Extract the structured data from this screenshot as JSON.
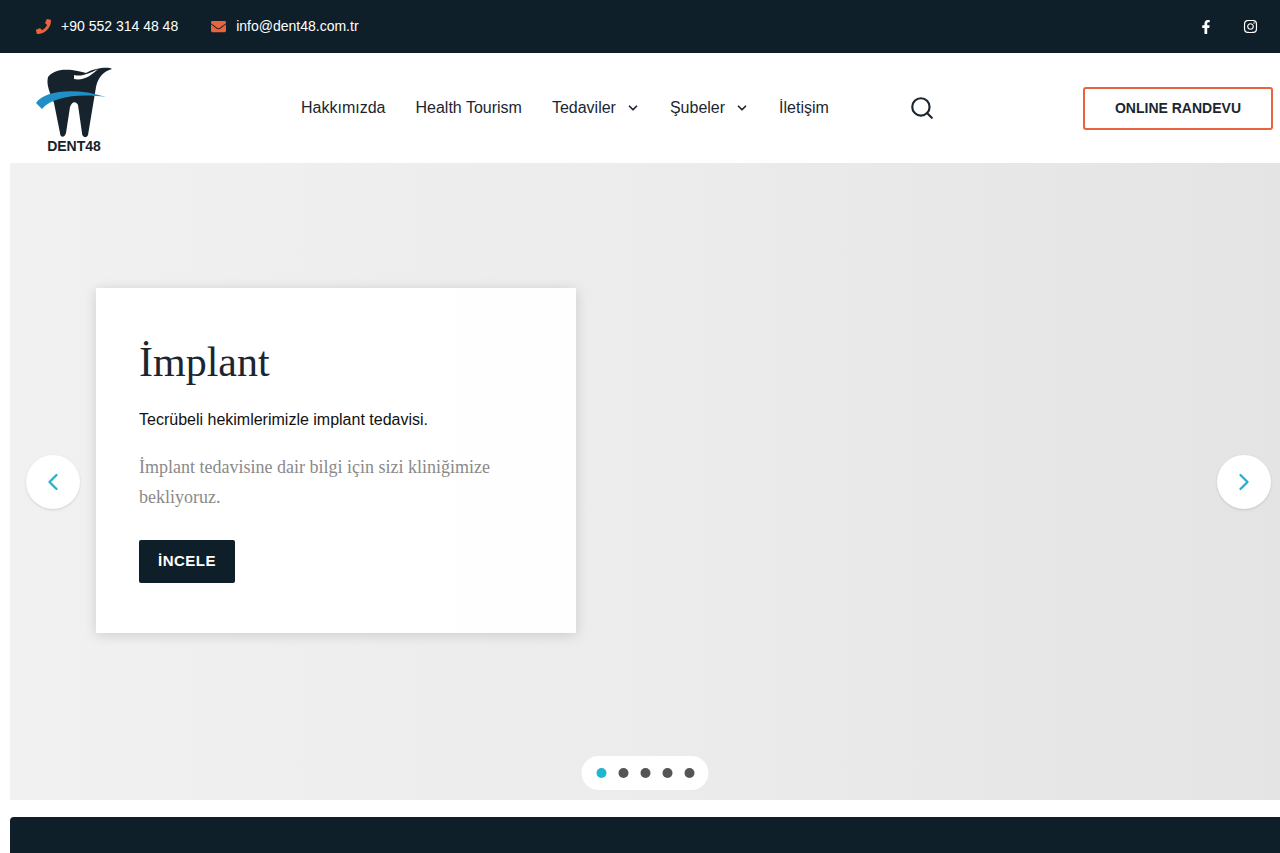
{
  "topbar": {
    "phone": "+90 552 314 48 48",
    "email": "info@dent48.com.tr"
  },
  "logo": {
    "text": "DENT48"
  },
  "nav": [
    {
      "label": "Hakkımızda",
      "dropdown": false
    },
    {
      "label": "Health Tourism",
      "dropdown": false
    },
    {
      "label": "Tedaviler",
      "dropdown": true
    },
    {
      "label": "Şubeler",
      "dropdown": true
    },
    {
      "label": "İletişim",
      "dropdown": false
    }
  ],
  "cta": "ONLINE RANDEVU",
  "slider": {
    "title": "İmplant",
    "subtitle": "Tecrübeli hekimlerimizle implant tedavisi.",
    "text": "İmplant tedavisine dair bilgi için sizi kliniğimize bekliyoruz.",
    "button": "İNCELE",
    "dots": [
      {
        "selected": true
      },
      {
        "selected": false
      },
      {
        "selected": false
      },
      {
        "selected": false
      },
      {
        "selected": false
      }
    ]
  }
}
